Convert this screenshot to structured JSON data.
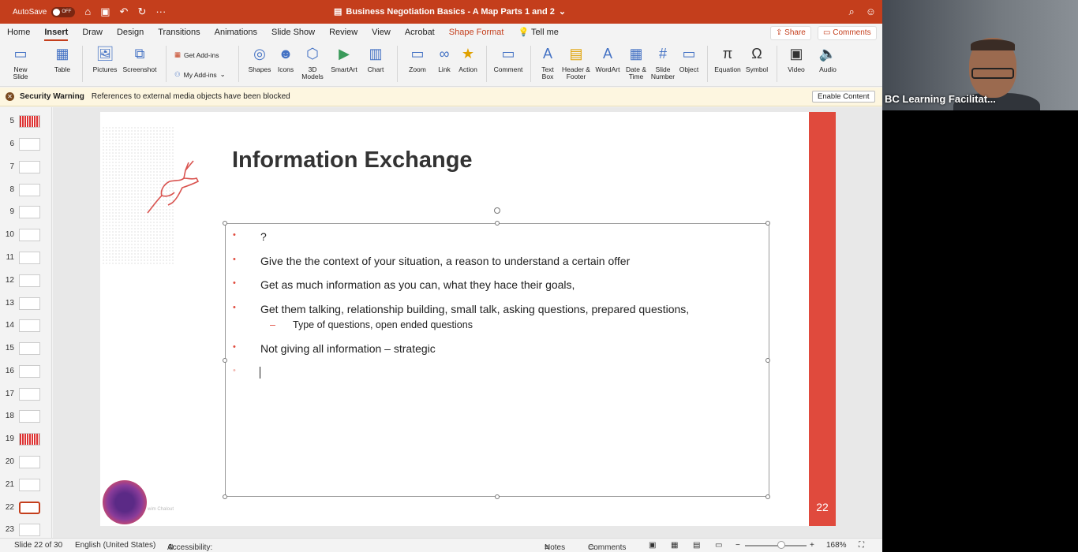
{
  "titlebar": {
    "autosave": "AutoSave",
    "toggle": "OFF",
    "doc_title": "Business Negotiation Basics - A Map Parts 1 and 2",
    "accent": "#c43e1c"
  },
  "tabs": [
    "Home",
    "Insert",
    "Draw",
    "Design",
    "Transitions",
    "Animations",
    "Slide Show",
    "Review",
    "View",
    "Acrobat",
    "Shape Format",
    "Tell me"
  ],
  "share": "Share",
  "comments": "Comments",
  "ribbon": {
    "new_slide": "New Slide",
    "table": "Table",
    "pictures": "Pictures",
    "screenshot": "Screenshot",
    "get_addins": "Get Add-ins",
    "my_addins": "My Add-ins",
    "shapes": "Shapes",
    "icons": "Icons",
    "models": "3D Models",
    "smartart": "SmartArt",
    "chart": "Chart",
    "zoom": "Zoom",
    "link": "Link",
    "action": "Action",
    "comment": "Comment",
    "textbox": "Text Box",
    "header_footer": "Header & Footer",
    "wordart": "WordArt",
    "date_time": "Date & Time",
    "slide_number": "Slide Number",
    "object": "Object",
    "equation": "Equation",
    "symbol": "Symbol",
    "video": "Video",
    "audio": "Audio"
  },
  "security": {
    "label": "Security Warning",
    "message": "References to external media objects have been blocked",
    "button": "Enable Content"
  },
  "thumbs": [
    "5",
    "6",
    "7",
    "8",
    "9",
    "10",
    "11",
    "12",
    "13",
    "14",
    "15",
    "16",
    "17",
    "18",
    "19",
    "20",
    "21",
    "22",
    "23"
  ],
  "slide": {
    "title": "Information Exchange",
    "number": "22",
    "logo_text": "wim Chalout",
    "bullets": [
      "?",
      "Give the the context of your situation, a reason to understand a certain offer",
      "Get as much information as you can, what they hace their goals,",
      "Get them talking, relationship building, small talk, asking questions, prepared questions,",
      "Not giving all information – strategic"
    ],
    "sub_bullet": "Type of questions, open ended questions"
  },
  "status": {
    "slide_of": "Slide 22 of 30",
    "language": "English (United States)",
    "accessibility": "Accessibility: Investigate",
    "notes": "Notes",
    "comments": "Comments",
    "zoom": "168%"
  },
  "video": {
    "name": "BC Learning Facilitat..."
  }
}
